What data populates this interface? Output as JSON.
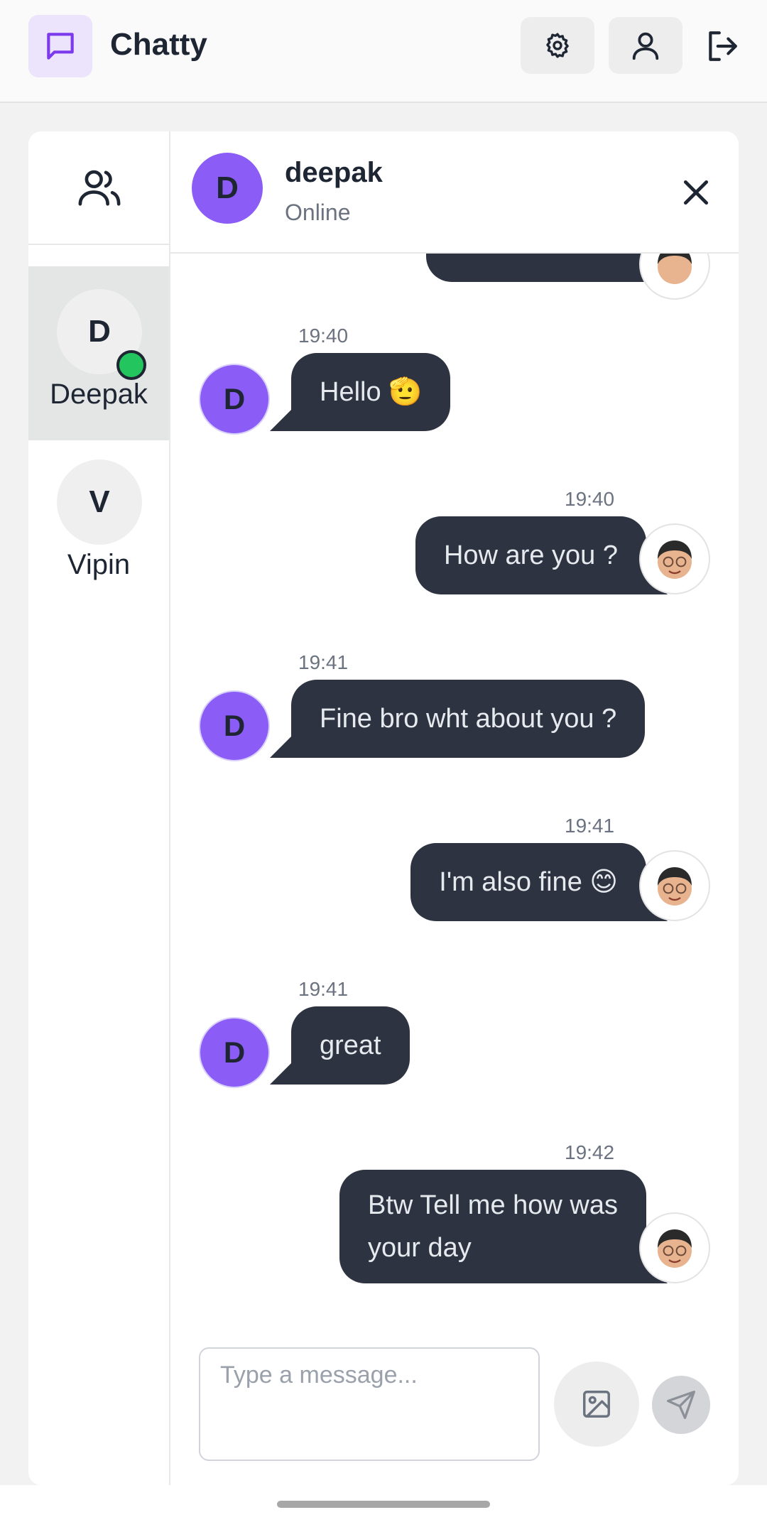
{
  "app": {
    "title": "Chatty"
  },
  "sidebar": {
    "contacts": [
      {
        "initial": "D",
        "name": "Deepak",
        "active": true,
        "online": true
      },
      {
        "initial": "V",
        "name": "Vipin",
        "active": false,
        "online": false
      }
    ]
  },
  "chat": {
    "contact_initial": "D",
    "contact_name": "deepak",
    "status": "Online"
  },
  "messages": [
    {
      "time": "19:40",
      "text": "Hello 🫡",
      "direction": "in"
    },
    {
      "time": "19:40",
      "text": "How are you ?",
      "direction": "out"
    },
    {
      "time": "19:41",
      "text": "Fine bro wht about you ?",
      "direction": "in"
    },
    {
      "time": "19:41",
      "text": "I'm also fine 😊",
      "direction": "out"
    },
    {
      "time": "19:41",
      "text": "great",
      "direction": "in"
    },
    {
      "time": "19:42",
      "text_line1": "Btw Tell me how was",
      "text_line2": "your day",
      "direction": "out"
    }
  ],
  "composer": {
    "placeholder": "Type a message..."
  },
  "colors": {
    "accent": "#8b5cf6",
    "bubble": "#2d3340",
    "online": "#22c55e",
    "logo_bg": "#ece4fd"
  }
}
